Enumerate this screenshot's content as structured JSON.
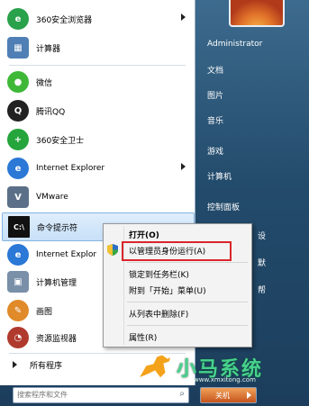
{
  "programs": [
    {
      "label": "360安全浏览器",
      "icon": "browser-360-icon",
      "color": "#2aa14b",
      "submenu": true
    },
    {
      "label": "计算器",
      "icon": "calculator-icon",
      "color": "#4f7fb4",
      "submenu": false
    },
    {
      "label": "微信",
      "icon": "wechat-icon",
      "color": "#3fb838",
      "submenu": false
    },
    {
      "label": "腾讯QQ",
      "icon": "qq-icon",
      "color": "#222222",
      "submenu": false
    },
    {
      "label": "360安全卫士",
      "icon": "security-360-icon",
      "color": "#25a53c",
      "submenu": false
    },
    {
      "label": "Internet Explorer",
      "icon": "ie-icon",
      "color": "#2b78d6",
      "submenu": true
    },
    {
      "label": "VMware",
      "icon": "vmware-icon",
      "color": "#5b6f88",
      "submenu": false
    },
    {
      "label": "命令提示符",
      "icon": "cmd-icon",
      "color": "#111111",
      "submenu": false
    },
    {
      "label": "Internet Explor",
      "icon": "ie-icon",
      "color": "#2b78d6",
      "submenu": false
    },
    {
      "label": "计算机管理",
      "icon": "computer-management-icon",
      "color": "#7a8fa8",
      "submenu": false
    },
    {
      "label": "画图",
      "icon": "paint-icon",
      "color": "#e08a2a",
      "submenu": false
    },
    {
      "label": "资源监视器",
      "icon": "resource-monitor-icon",
      "color": "#b03a2e",
      "submenu": false
    }
  ],
  "all_programs": "所有程序",
  "search_placeholder": "搜索程序和文件",
  "right_menu": [
    "Administrator",
    "文档",
    "图片",
    "音乐",
    "游戏",
    "计算机",
    "控制面板",
    "设",
    "默",
    "帮"
  ],
  "shutdown_label": "关机",
  "context_menu": [
    "打开(O)",
    "以管理员身份运行(A)",
    "锁定到任务栏(K)",
    "附到「开始」菜单(U)",
    "从列表中删除(F)",
    "属性(R)"
  ],
  "watermark": "小马系统",
  "watermark_url": "www.xmxitong.com"
}
